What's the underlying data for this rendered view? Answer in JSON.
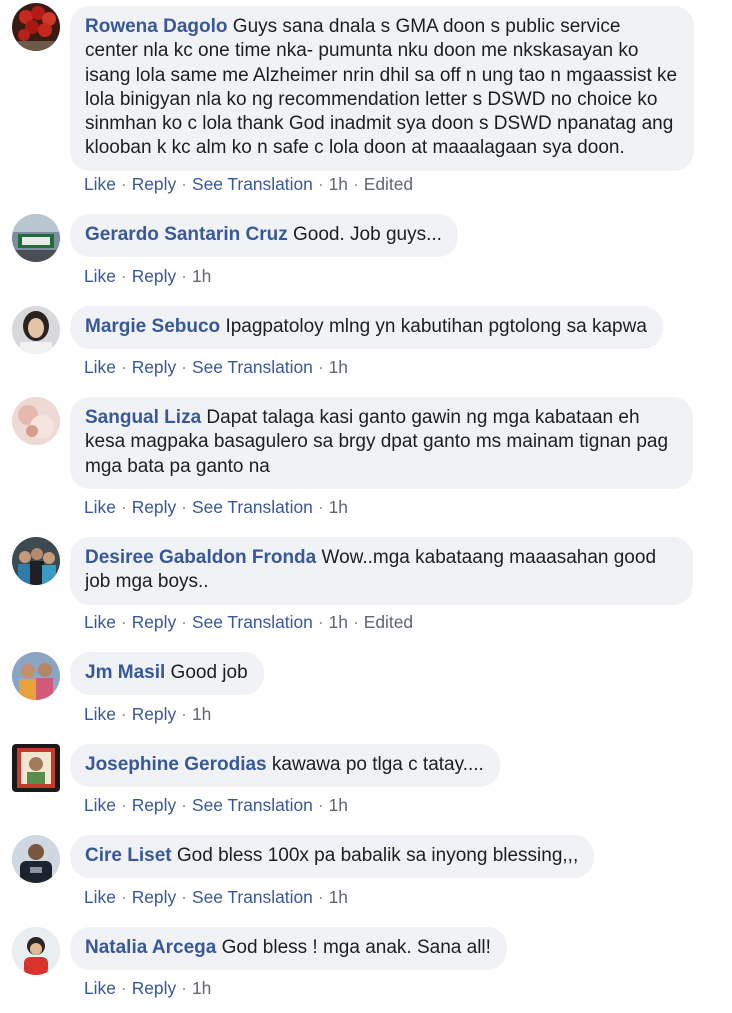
{
  "labels": {
    "like": "Like",
    "reply": "Reply",
    "see_translation": "See Translation",
    "edited": "Edited",
    "sep": "·"
  },
  "colors": {
    "author_link": "#385898",
    "bubble_bg": "#f0f2f5",
    "text": "#1c1e21",
    "meta": "#606770"
  },
  "comments": [
    {
      "author": "Rowena Dagolo",
      "text": "Guys sana dnala s GMA doon s public service center nla kc one time nka- pumunta nku doon me nkskasayan ko isang lola same me Alzheimer nrin dhil sa off n ung tao n mgaassist ke lola binigyan nla ko ng recommendation letter s DSWD no choice ko sinmhan ko c lola thank God inadmit sya doon s DSWD npanatag ang klooban k kc alm ko n safe c lola doon at maaalagaan sya doon.",
      "time": "1h",
      "has_translation": true,
      "edited": true,
      "avatar_icon": "avatar-roses-icon"
    },
    {
      "author": "Gerardo Santarin Cruz",
      "text": "Good. Job guys...",
      "time": "1h",
      "has_translation": false,
      "edited": false,
      "avatar_icon": "avatar-atm-sign-icon"
    },
    {
      "author": "Margie Sebuco",
      "text": "Ipagpatoloy mlng yn kabutihan pgtolong sa kapwa",
      "time": "1h",
      "has_translation": true,
      "edited": false,
      "avatar_icon": "avatar-woman-portrait-icon"
    },
    {
      "author": "Sangual Liza",
      "text": "Dapat talaga kasi ganto gawin ng mga kabataan eh kesa magpaka basagulero sa brgy dpat ganto ms mainam tignan pag mga bata pa ganto na",
      "time": "1h",
      "has_translation": true,
      "edited": false,
      "avatar_icon": "avatar-pink-blur-icon"
    },
    {
      "author": "Desiree Gabaldon Fronda",
      "text": "Wow..mga kabataang maaasahan good job mga boys..",
      "time": "1h",
      "has_translation": true,
      "edited": true,
      "avatar_icon": "avatar-group-photo-icon"
    },
    {
      "author": "Jm Masil",
      "text": "Good job",
      "time": "1h",
      "has_translation": false,
      "edited": false,
      "avatar_icon": "avatar-couple-photo-icon"
    },
    {
      "author": "Josephine Gerodias",
      "text": "kawawa po tlga c tatay....",
      "time": "1h",
      "has_translation": true,
      "edited": false,
      "avatar_icon": "avatar-framed-portrait-icon"
    },
    {
      "author": "Cire Liset",
      "text": "God bless 100x pa babalik sa inyong blessing,,,",
      "time": "1h",
      "has_translation": true,
      "edited": false,
      "avatar_icon": "avatar-dark-shirt-icon"
    },
    {
      "author": "Natalia Arcega",
      "text": "God bless ! mga anak. Sana all!",
      "time": "1h",
      "has_translation": false,
      "edited": false,
      "avatar_icon": "avatar-child-portrait-icon"
    }
  ]
}
